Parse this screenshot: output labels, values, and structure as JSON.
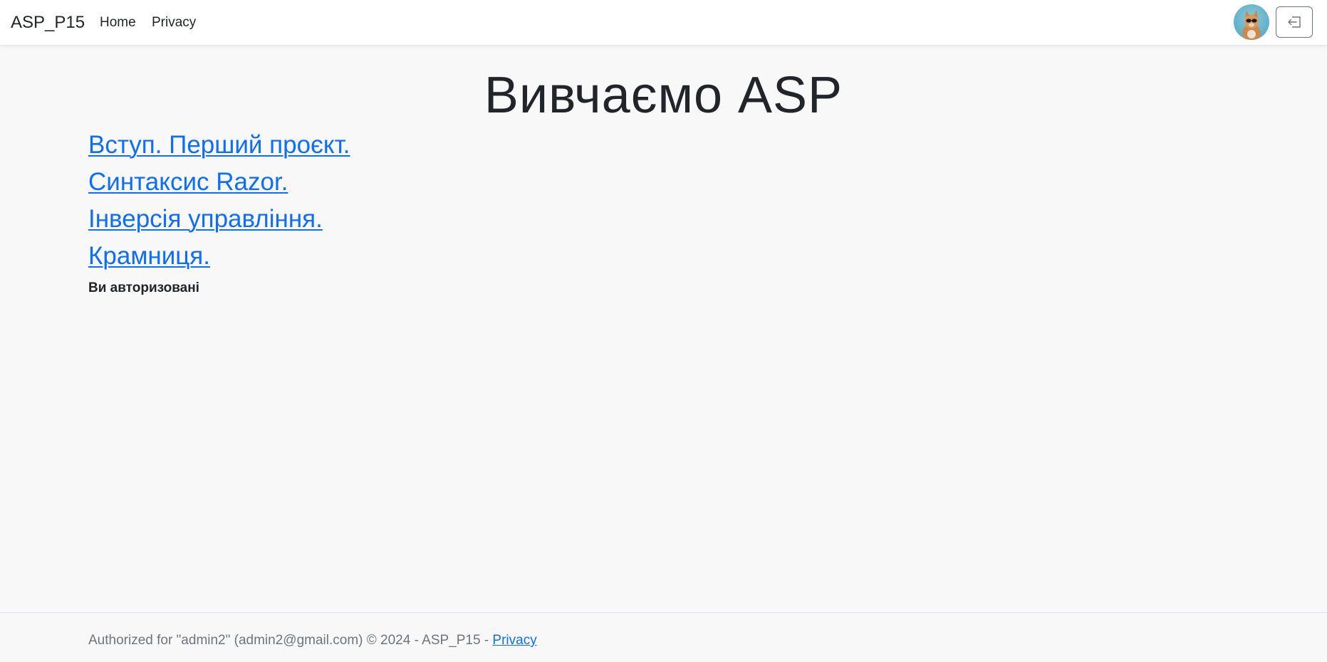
{
  "navbar": {
    "brand": "ASP_P15",
    "links": [
      {
        "label": "Home"
      },
      {
        "label": "Privacy"
      }
    ],
    "avatar_icon": "user-avatar-cat",
    "logout_icon": "sign-out-icon"
  },
  "main": {
    "title": "Вивчаємо ASP",
    "lessons": [
      {
        "label": "Вступ. Перший проєкт."
      },
      {
        "label": "Синтаксис Razor."
      },
      {
        "label": "Інверсія управління."
      },
      {
        "label": "Крамниця."
      }
    ],
    "auth_status": "Ви авторизовані"
  },
  "footer": {
    "text": "Authorized for \"admin2\" (admin2@gmail.com) © 2024 - ASP_P15 - ",
    "privacy_link": "Privacy"
  },
  "colors": {
    "link": "#0d6efd",
    "background": "#f8f8f8",
    "footer_text": "#6c757d"
  }
}
